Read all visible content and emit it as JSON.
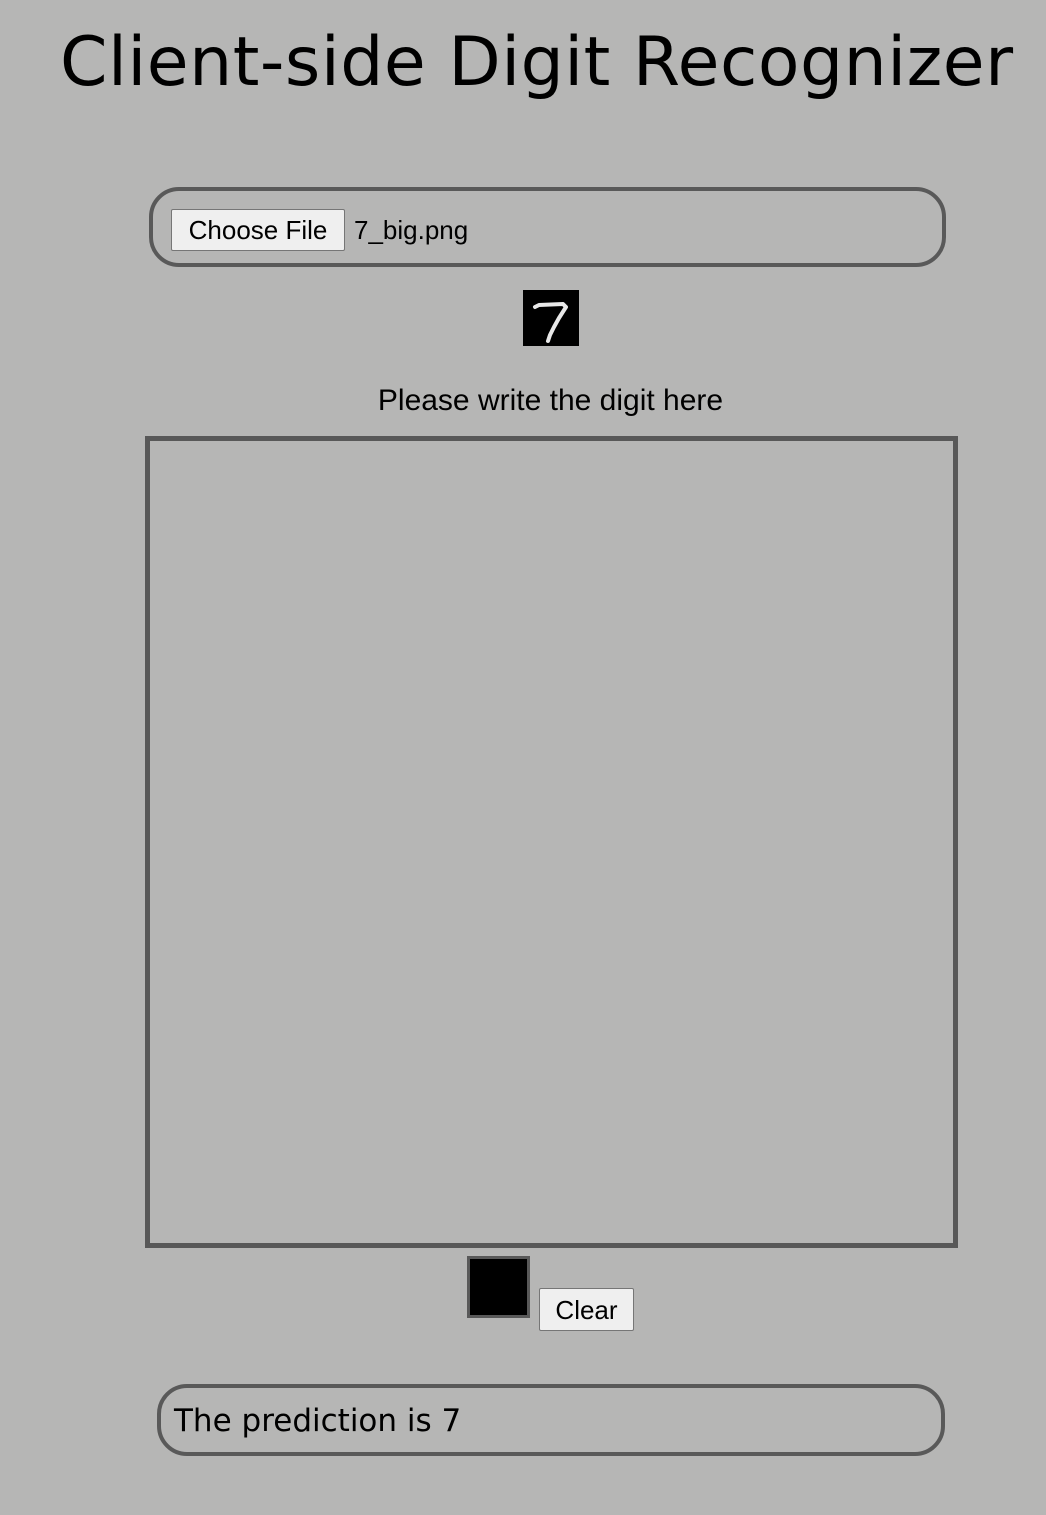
{
  "page": {
    "title": "Client-side Digit Recognizer",
    "background_color": "#b6b6b5",
    "border_color": "#595959"
  },
  "file_input": {
    "button_label": "Choose File",
    "file_name": "7_big.png"
  },
  "thumbnail": {
    "digit": "7",
    "icon": "digit-seven-image"
  },
  "canvas": {
    "label": "Please write the digit here"
  },
  "controls": {
    "preview_color": "#000000",
    "clear_label": "Clear"
  },
  "result": {
    "text": "The prediction is 7"
  }
}
